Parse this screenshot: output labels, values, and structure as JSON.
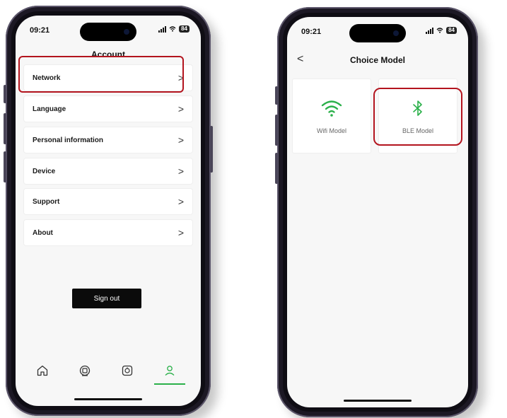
{
  "phone_left": {
    "status_time": "09:21",
    "battery": "84",
    "title": "Account",
    "menu": [
      {
        "label": "Network"
      },
      {
        "label": "Language"
      },
      {
        "label": "Personal information"
      },
      {
        "label": "Device"
      },
      {
        "label": "Support"
      },
      {
        "label": "About"
      }
    ],
    "chevron": ">",
    "sign_out": "Sign out",
    "tabs": [
      "home-icon",
      "device-hub-icon",
      "scan-icon",
      "profile-icon"
    ],
    "active_tab": "profile-icon",
    "accent_color": "#2bb04a",
    "highlight_color": "#b3141e"
  },
  "phone_right": {
    "status_time": "09:21",
    "battery": "84",
    "title": "Choice Model",
    "back": "<",
    "options": [
      {
        "label": "Wifi Model",
        "icon": "wifi-icon"
      },
      {
        "label": "BLE Model",
        "icon": "bluetooth-icon"
      }
    ],
    "icon_color": "#2bb04a"
  }
}
